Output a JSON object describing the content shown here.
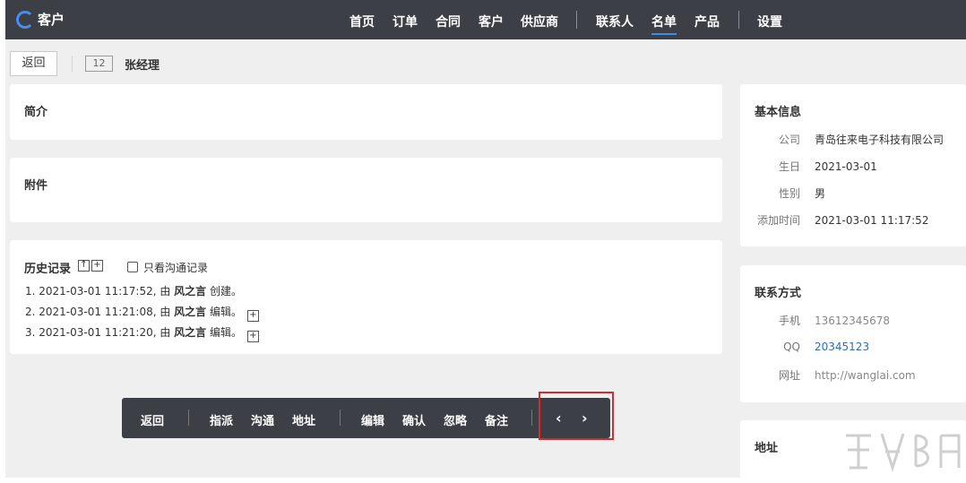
{
  "app": {
    "title": "客户"
  },
  "nav": {
    "items": [
      "首页",
      "订单",
      "合同",
      "客户",
      "供应商",
      "联系人",
      "名单",
      "产品",
      "设置"
    ],
    "active": "名单"
  },
  "header": {
    "back_label": "返回",
    "record_id": "12",
    "name": "张经理"
  },
  "sections": {
    "intro": "简介",
    "attachments": "附件"
  },
  "history": {
    "title": "历史记录",
    "filter_label": "只看沟通记录",
    "entries": [
      {
        "prefix": "1. 2021-03-01 11:17:52, 由 ",
        "user": "风之言",
        "action": " 创建。"
      },
      {
        "prefix": "2. 2021-03-01 11:21:08, 由 ",
        "user": "风之言",
        "action": " 编辑。"
      },
      {
        "prefix": "3. 2021-03-01 11:21:20, 由 ",
        "user": "风之言",
        "action": " 编辑。"
      }
    ]
  },
  "basic_info": {
    "title": "基本信息",
    "fields": [
      {
        "label": "公司",
        "value": "青岛往来电子科技有限公司"
      },
      {
        "label": "生日",
        "value": "2021-03-01"
      },
      {
        "label": "性别",
        "value": "男"
      },
      {
        "label": "添加时间",
        "value": "2021-03-01 11:17:52"
      }
    ]
  },
  "contact_info": {
    "title": "联系方式",
    "fields": [
      {
        "label": "手机",
        "value": "13612345678"
      },
      {
        "label": "QQ",
        "value": "20345123"
      },
      {
        "label": "网址",
        "value": "http://wanglai.com"
      }
    ]
  },
  "address": {
    "title": "地址"
  },
  "toolbar": {
    "back": "返回",
    "assign": "指派",
    "communicate": "沟通",
    "address": "地址",
    "edit": "编辑",
    "confirm": "确认",
    "ignore": "忽略",
    "note": "备注",
    "prev": "‹",
    "next": "›"
  },
  "colors": {
    "nav_bg": "#3c3f45",
    "accent": "#3d8ce8",
    "highlight": "#d9282e",
    "link": "#2b6fb8"
  }
}
